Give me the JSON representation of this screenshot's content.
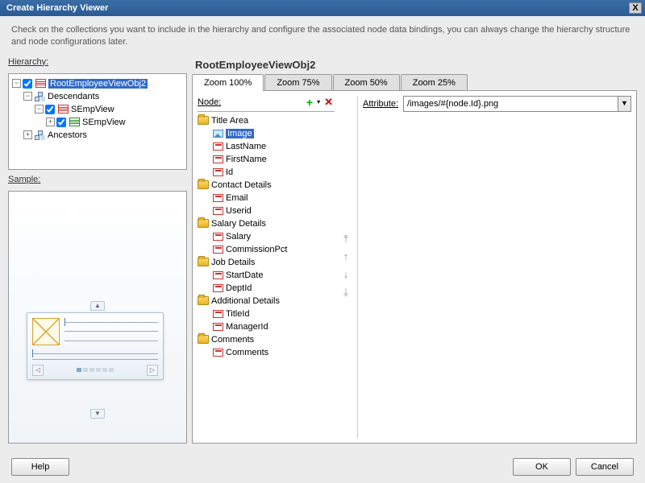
{
  "window": {
    "title": "Create Hierarchy Viewer",
    "close": "X"
  },
  "description": "Check on the collections you want to include in the hierarchy and configure the associated node data bindings, you can always change the hierarchy structure and node configurations later.",
  "labels": {
    "hierarchy": "Hierarchy:",
    "sample": "Sample:",
    "node": "Node:",
    "attribute": "Attribute:"
  },
  "hierarchy": {
    "root": "RootEmployeeViewObj2",
    "descendants": "Descendants",
    "semp1": "SEmpView",
    "semp2": "SEmpView",
    "ancestors": "Ancestors"
  },
  "section_title": "RootEmployeeViewObj2",
  "tabs": [
    "Zoom 100%",
    "Zoom 75%",
    "Zoom 50%",
    "Zoom 25%"
  ],
  "active_tab": 0,
  "node_tree": [
    {
      "label": "Title Area",
      "type": "folder",
      "children": [
        {
          "label": "Image",
          "type": "image",
          "selected": true
        },
        {
          "label": "LastName",
          "type": "leaf"
        },
        {
          "label": "FirstName",
          "type": "leaf"
        },
        {
          "label": "Id",
          "type": "leaf"
        }
      ]
    },
    {
      "label": "Contact Details",
      "type": "folder",
      "children": [
        {
          "label": "Email",
          "type": "leaf"
        },
        {
          "label": "Userid",
          "type": "leaf"
        }
      ]
    },
    {
      "label": "Salary Details",
      "type": "folder",
      "children": [
        {
          "label": "Salary",
          "type": "leaf"
        },
        {
          "label": "CommissionPct",
          "type": "leaf"
        }
      ]
    },
    {
      "label": "Job Details",
      "type": "folder",
      "children": [
        {
          "label": "StartDate",
          "type": "leaf"
        },
        {
          "label": "DeptId",
          "type": "leaf"
        }
      ]
    },
    {
      "label": "Additional Details",
      "type": "folder",
      "children": [
        {
          "label": "TitleId",
          "type": "leaf"
        },
        {
          "label": "ManagerId",
          "type": "leaf"
        }
      ]
    },
    {
      "label": "Comments",
      "type": "folder",
      "children": [
        {
          "label": "Comments",
          "type": "leaf"
        }
      ]
    }
  ],
  "attribute_value": "/images/#{node.Id}.png",
  "buttons": {
    "help": "Help",
    "ok": "OK",
    "cancel": "Cancel",
    "add": "+",
    "dd": "▾",
    "del": "✕"
  },
  "move": {
    "top": "⤒",
    "up": "↑",
    "down": "↓",
    "bottom": "⤓"
  }
}
